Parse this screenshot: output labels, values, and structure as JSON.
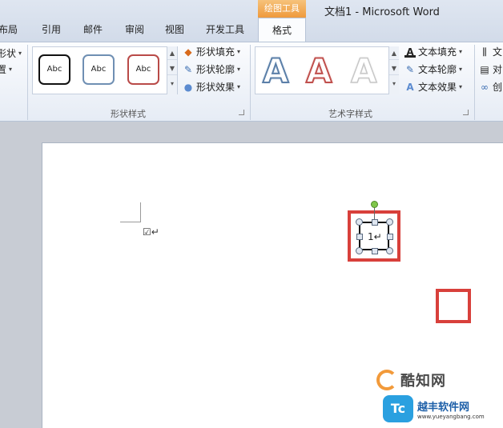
{
  "window": {
    "title": "文档1 - Microsoft Word"
  },
  "tabs": [
    "布局",
    "引用",
    "邮件",
    "审阅",
    "视图",
    "开发工具"
  ],
  "contextual_tab": {
    "label": "绘图工具",
    "tab": "格式"
  },
  "ribbon": {
    "left_cut": {
      "row1": "形状",
      "row2": "置"
    },
    "shape_styles": {
      "group_label": "形状样式",
      "gallery": [
        "Abc",
        "Abc",
        "Abc"
      ],
      "commands": {
        "fill": "形状填充",
        "outline": "形状轮廓",
        "effects": "形状效果"
      }
    },
    "wordart_styles": {
      "group_label": "艺术字样式",
      "gallery": [
        "A",
        "A",
        "A"
      ],
      "commands": {
        "fill": "文本填充",
        "outline": "文本轮廓",
        "effects": "文本效果"
      }
    },
    "text_cut": {
      "row1": "文",
      "row2": "对",
      "row3": "创"
    }
  },
  "document": {
    "checkbox_text": "☑↵",
    "shape_text": "1↵"
  },
  "watermarks": {
    "brand1": "酷知网",
    "brand2_logo": "Tc",
    "brand2_name": "越丰软件网",
    "brand2_url": "www.yueyangbang.com"
  },
  "colors": {
    "accent": "#d8403b",
    "contextual": "#ef9a3c",
    "ribbon": "#e6ecf5"
  }
}
